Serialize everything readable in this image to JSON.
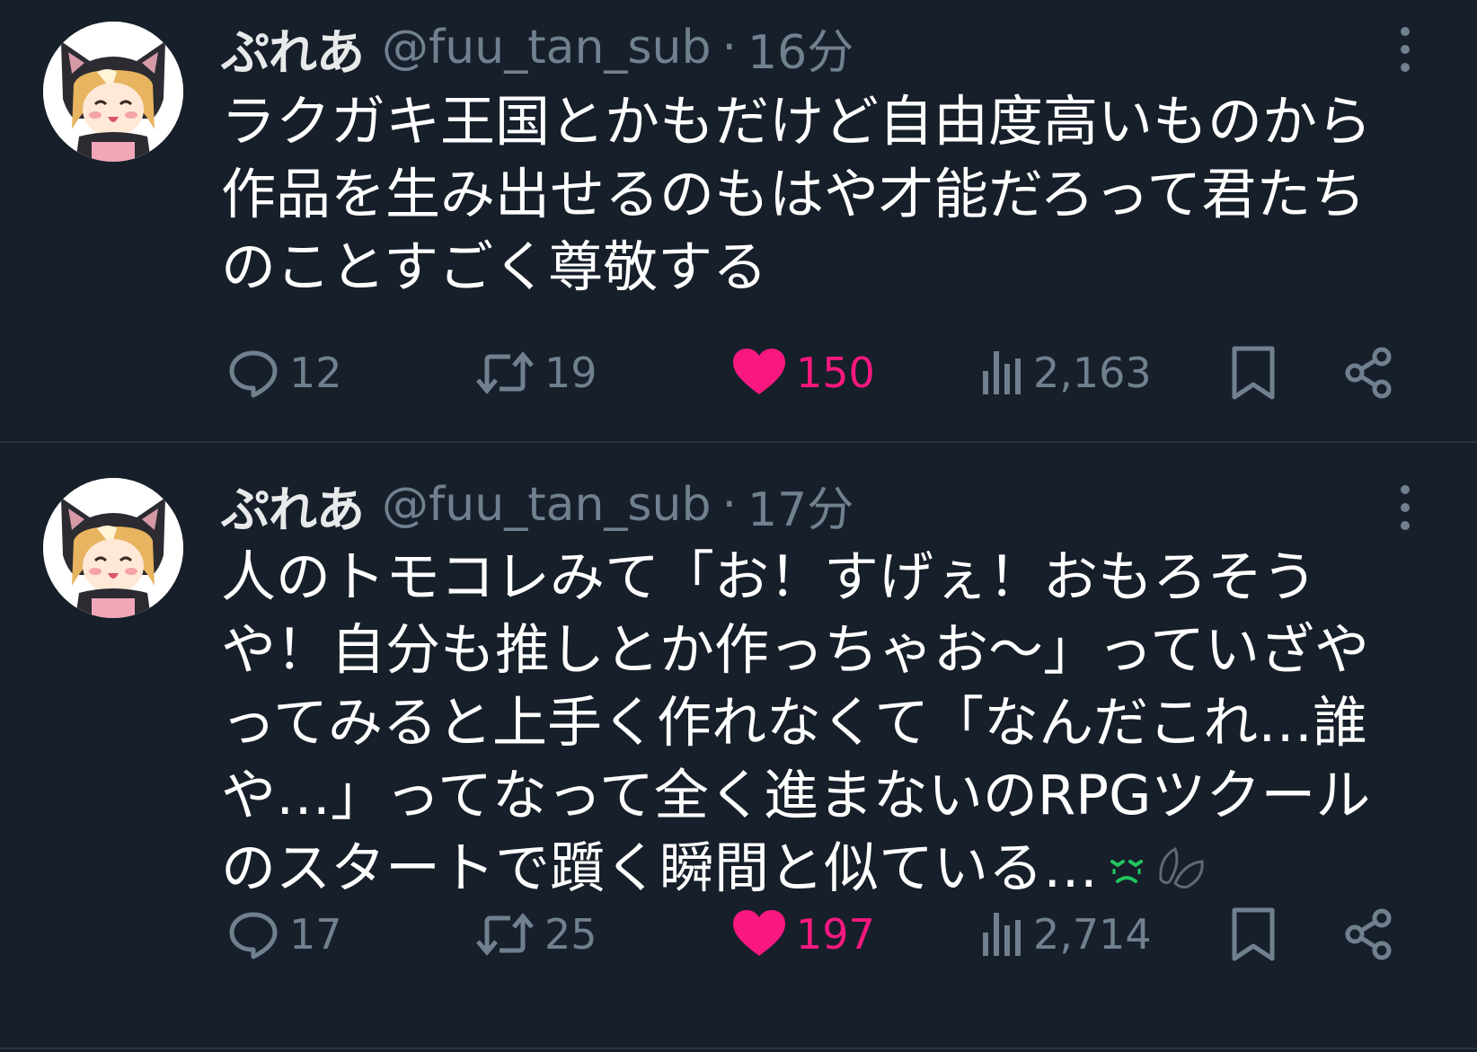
{
  "tweets": [
    {
      "author_name": "ぷれあ",
      "handle": "@fuu_tan_sub",
      "separator": "·",
      "time": "16分",
      "text_lines": [
        "ラクガキ王国とかもだけど自由度高いものから",
        "作品を生み出せるのもはや才能だろって君たち",
        "のことすごく尊敬する"
      ],
      "reply_count": "12",
      "retweet_count": "19",
      "like_count": "150",
      "view_count": "2,163"
    },
    {
      "author_name": "ぷれあ",
      "handle": "@fuu_tan_sub",
      "separator": "·",
      "time": "17分",
      "text_lines": [
        "人のトモコレみて「お！すげぇ！おもろそう",
        "や！自分も推しとか作っちゃお〜」っていざや",
        "ってみると上手く作れなくて「なんだこれ…誰",
        "や…」ってなって全く進まないのRPGツクール",
        "のスタートで躓く瞬間と似ている…"
      ],
      "emojis": [
        "crying-face-emoji",
        "sweat-droplet-emoji"
      ],
      "reply_count": "17",
      "retweet_count": "25",
      "like_count": "197",
      "view_count": "2,714"
    }
  ],
  "icons": {
    "reply": "reply-icon",
    "retweet": "retweet-icon",
    "like": "heart-icon",
    "views": "views-icon",
    "bookmark": "bookmark-icon",
    "share": "share-icon",
    "more": "more-vertical-icon"
  },
  "colors": {
    "background": "#161f2a",
    "text": "#ffffff",
    "muted": "#71808f",
    "like_active": "#f91880",
    "divider": "#2a3441"
  }
}
